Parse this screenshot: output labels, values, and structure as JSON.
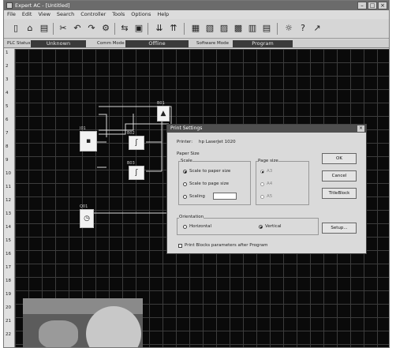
{
  "window": {
    "title": "Expert AC - [Untitled]",
    "menu": [
      "File",
      "Edit",
      "View",
      "Search",
      "Controller",
      "Tools",
      "Options",
      "Help"
    ]
  },
  "status": {
    "plc_status_label": "PLC Status",
    "plc_status_value": "Unknown",
    "comm_mode_label": "Comm Mode",
    "comm_mode_value": "Offline",
    "software_mode_label": "Software Mode",
    "software_mode_value": "Program"
  },
  "ruler": [
    "1",
    "2",
    "3",
    "4",
    "5",
    "6",
    "7",
    "8",
    "9",
    "10",
    "11",
    "12",
    "13",
    "14",
    "15",
    "16",
    "17",
    "18",
    "19",
    "20",
    "21",
    "22"
  ],
  "blocks": [
    {
      "id": "B1",
      "label": "B01",
      "icon": "▲"
    },
    {
      "id": "B2",
      "label": "I01",
      "icon": "▪"
    },
    {
      "id": "B3",
      "label": "B02",
      "icon": "ʃ"
    },
    {
      "id": "B4",
      "label": "B03",
      "icon": "ʃ"
    },
    {
      "id": "B5",
      "label": "Q01",
      "icon": "◷"
    }
  ],
  "dialog": {
    "title": "Print Settings",
    "printer_label": "Printer:",
    "printer_value": "hp LaserJet 1020",
    "paper_size_label": "Paper Size",
    "scale_label": "Scale",
    "scale_options": [
      "Scale to paper size",
      "Scale to page size",
      "Scaling"
    ],
    "page_size_label": "Page size",
    "page_size_options": [
      "A3",
      "A4",
      "A5"
    ],
    "orientation_label": "Orientation",
    "orientation_options": [
      "Horizontal",
      "Vertical"
    ],
    "print_params_label": "Print Blocks parameters after Program",
    "buttons": {
      "ok": "OK",
      "cancel": "Cancel",
      "title_block": "TitleBlock",
      "setup": "Setup..."
    }
  },
  "colors": {
    "canvas": "#0a0a0a",
    "grid": "#3c3c3c",
    "status_field": "#3a3a3a"
  }
}
